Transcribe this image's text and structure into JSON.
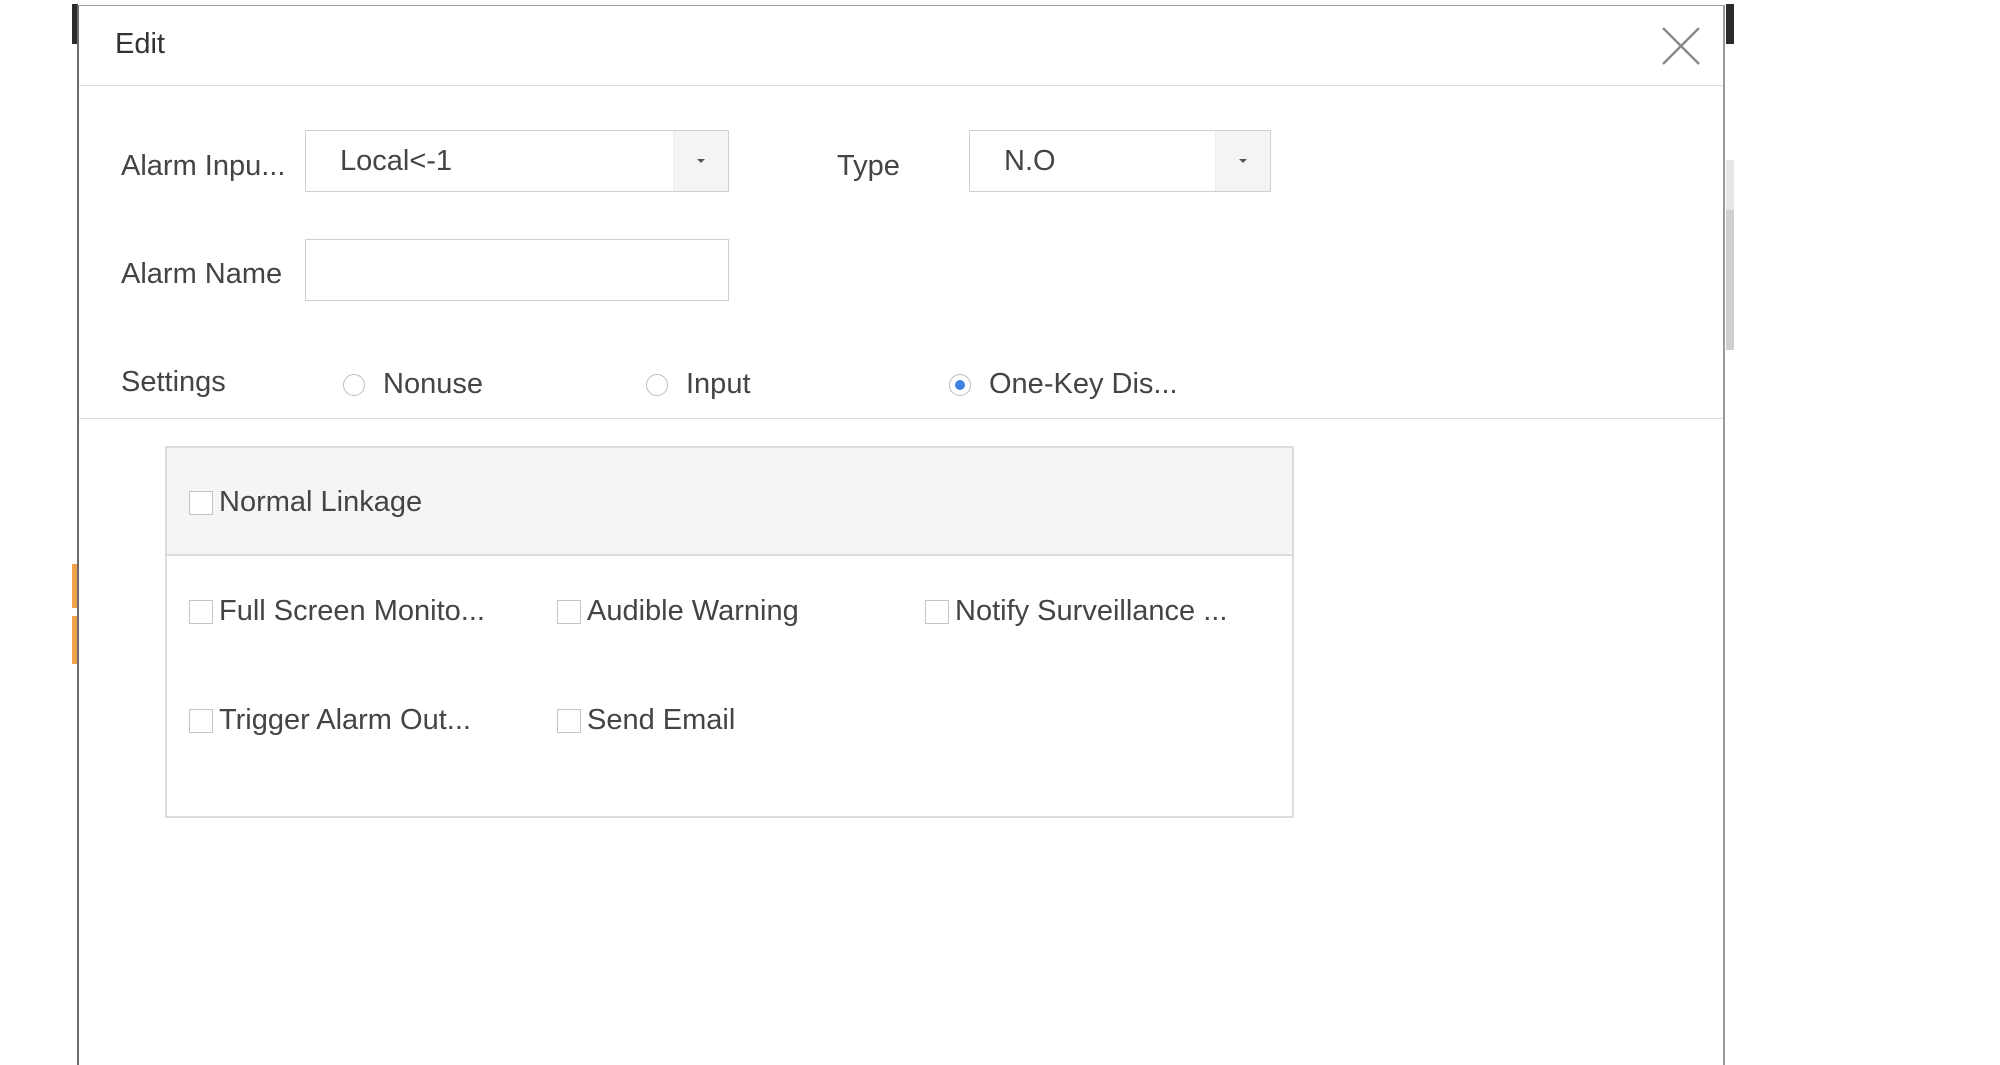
{
  "dialog": {
    "title": "Edit",
    "close_icon": "close-icon"
  },
  "form": {
    "alarm_input": {
      "label": "Alarm Inpu...",
      "value": "Local<-1"
    },
    "type": {
      "label": "Type",
      "value": "N.O"
    },
    "alarm_name": {
      "label": "Alarm Name",
      "value": "",
      "placeholder": ""
    },
    "settings": {
      "label": "Settings",
      "options": [
        {
          "label": "Nonuse",
          "checked": false
        },
        {
          "label": "Input",
          "checked": false
        },
        {
          "label": "One-Key Dis...",
          "checked": true
        }
      ]
    }
  },
  "linkage": {
    "header_label": "Normal Linkage",
    "items": [
      {
        "label": "Full Screen Monito...",
        "checked": false
      },
      {
        "label": "Audible Warning",
        "checked": false
      },
      {
        "label": "Notify Surveillance ...",
        "checked": false
      },
      {
        "label": "Trigger Alarm Out...",
        "checked": false
      },
      {
        "label": "Send Email",
        "checked": false
      }
    ]
  },
  "colors": {
    "accent": "#3c83e0",
    "border": "#dcdcdc",
    "text": "#444444"
  }
}
